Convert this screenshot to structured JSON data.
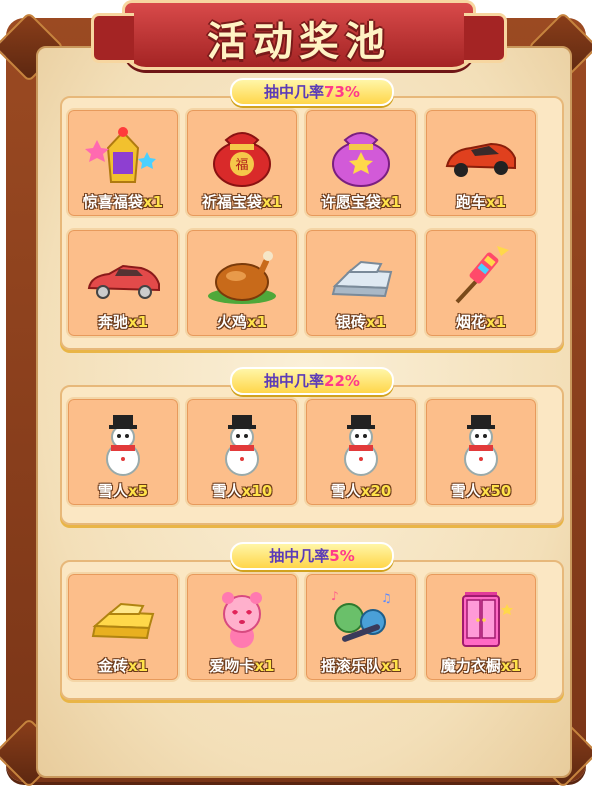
{
  "title": "活动奖池",
  "pools": [
    {
      "label": "抽中几率",
      "percent": "73%",
      "items": [
        {
          "name": "惊喜福袋",
          "qty": "x1",
          "icon": "surprise-bag-icon"
        },
        {
          "name": "祈福宝袋",
          "qty": "x1",
          "icon": "blessing-bag-icon"
        },
        {
          "name": "许愿宝袋",
          "qty": "x1",
          "icon": "wish-bag-icon"
        },
        {
          "name": "跑车",
          "qty": "x1",
          "icon": "sports-car-icon"
        },
        {
          "name": "奔驰",
          "qty": "x1",
          "icon": "benz-car-icon"
        },
        {
          "name": "火鸡",
          "qty": "x1",
          "icon": "turkey-icon"
        },
        {
          "name": "银砖",
          "qty": "x1",
          "icon": "silver-brick-icon"
        },
        {
          "name": "烟花",
          "qty": "x1",
          "icon": "firework-icon"
        }
      ]
    },
    {
      "label": "抽中几率",
      "percent": "22%",
      "items": [
        {
          "name": "雪人",
          "qty": "x5",
          "icon": "snowman-icon"
        },
        {
          "name": "雪人",
          "qty": "x10",
          "icon": "snowman-icon"
        },
        {
          "name": "雪人",
          "qty": "x20",
          "icon": "snowman-icon"
        },
        {
          "name": "雪人",
          "qty": "x50",
          "icon": "snowman-icon"
        }
      ]
    },
    {
      "label": "抽中几率",
      "percent": "5%",
      "items": [
        {
          "name": "金砖",
          "qty": "x1",
          "icon": "gold-brick-icon"
        },
        {
          "name": "爱吻卡",
          "qty": "x1",
          "icon": "kiss-card-icon"
        },
        {
          "name": "摇滚乐队",
          "qty": "x1",
          "icon": "rock-band-icon"
        },
        {
          "name": "魔力衣橱",
          "qty": "x1",
          "icon": "magic-wardrobe-icon"
        }
      ]
    }
  ],
  "colors": {
    "banner": "#c43232",
    "card": "#fcbe8a",
    "pill_label": "#5b3bb8",
    "pill_percent": "#ff3b8a",
    "qty": "#ffe24a"
  }
}
